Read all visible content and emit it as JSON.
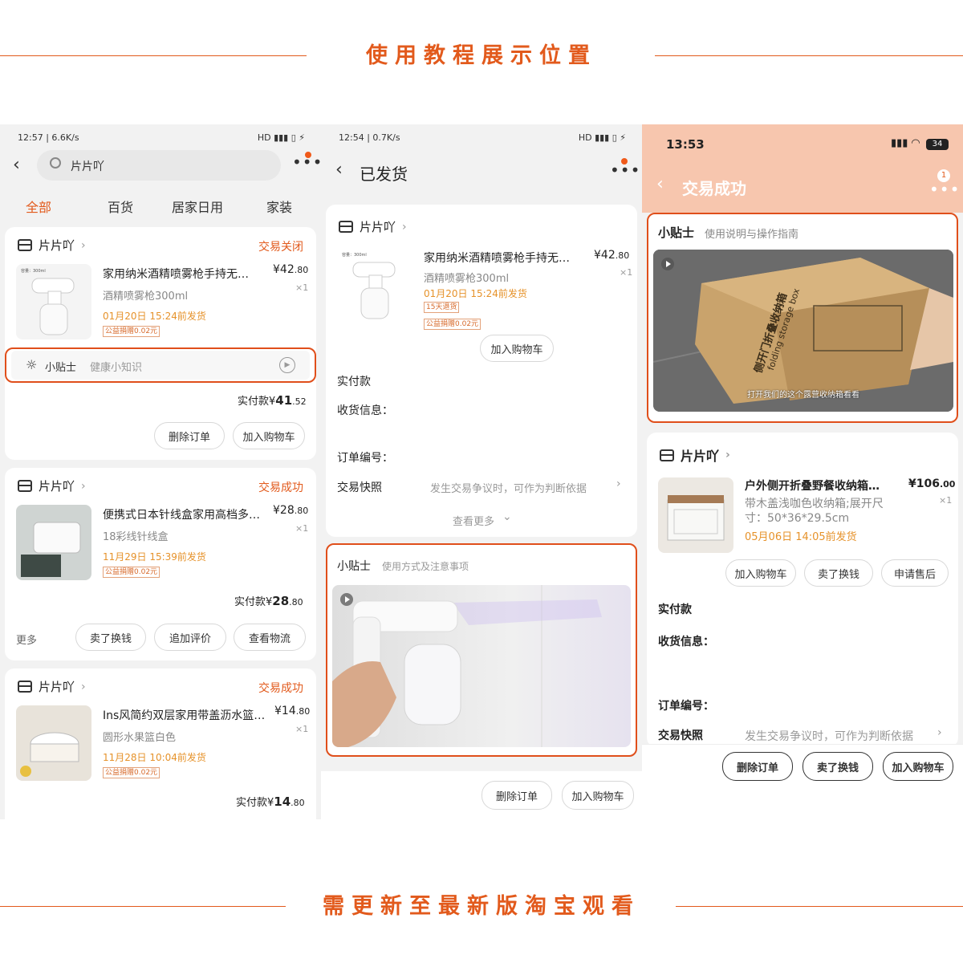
{
  "header_top": {
    "title": "使用教程展示位置"
  },
  "footer_bottom": {
    "title": "需更新至最新版淘宝观看"
  },
  "panel1": {
    "status_time": "12:57 | 6.6K/s",
    "status_right": "HD ▮▮▮ ▯ ⚡",
    "search_value": "片片吖",
    "tabs": [
      "全部",
      "百货",
      "居家日用",
      "家装"
    ],
    "order1": {
      "store": "片片吖",
      "state": "交易关闭",
      "thumb_text": "容量：300ml",
      "title": "家用纳米酒精喷雾枪手持无…",
      "spec": "酒精喷雾枪300ml",
      "date": "01月20日 15:24前发货",
      "tag": "公益捐赠0.02元",
      "price_symbol": "¥42",
      "price_dec": ".80",
      "qty": "×1",
      "tip_label": "小贴士",
      "tip_text": "健康小知识",
      "pay_label": "实付款¥",
      "pay_int": "41",
      "pay_dec": ".52",
      "btn1": "删除订单",
      "btn2": "加入购物车"
    },
    "order2": {
      "store": "片片吖",
      "state": "交易成功",
      "title": "便携式日本针线盒家用高档多…",
      "spec": "18彩线针线盒",
      "date": "11月29日 15:39前发货",
      "tag": "公益捐赠0.02元",
      "price_symbol": "¥28",
      "price_dec": ".80",
      "qty": "×1",
      "pay_label": "实付款¥",
      "pay_int": "28",
      "pay_dec": ".80",
      "more": "更多",
      "btn1": "卖了换钱",
      "btn2": "追加评价",
      "btn3": "查看物流"
    },
    "order3": {
      "store": "片片吖",
      "state": "交易成功",
      "title": "Ins风简约双层家用带盖沥水篮…",
      "spec": "圆形水果篮白色",
      "date": "11月28日 10:04前发货",
      "tag": "公益捐赠0.02元",
      "price_symbol": "¥14",
      "price_dec": ".80",
      "qty": "×1",
      "pay_label": "实付款¥",
      "pay_int": "14",
      "pay_dec": ".80"
    }
  },
  "panel2": {
    "status_time": "12:54 | 0.7K/s",
    "status_right": "HD ▮▮▮ ▯ ⚡",
    "title": "已发货",
    "store": "片片吖",
    "thumb_text": "容量：300ml",
    "product_title": "家用纳米酒精喷雾枪手持无…",
    "spec": "酒精喷雾枪300ml",
    "date": "01月20日 15:24前发货",
    "tag1": "15天退货",
    "tag2": "公益捐赠0.02元",
    "price_symbol": "¥42",
    "price_dec": ".80",
    "qty": "×1",
    "add_cart": "加入购物车",
    "paid": "实付款",
    "receive": "收货信息：",
    "order_no": "订单编号：",
    "snapshot": "交易快照",
    "snapshot_val": "发生交易争议时，可作为判断依据",
    "more": "查看更多",
    "tip_label": "小贴士",
    "tip_text": "使用方式及注意事项",
    "btn1": "删除订单",
    "btn2": "加入购物车"
  },
  "panel3": {
    "status_time": "13:53",
    "battery": "34",
    "title": "交易成功",
    "badge": "1",
    "tip_label": "小贴士",
    "tip_text": "使用说明与操作指南",
    "box_text": "侧开门折叠收纳箱",
    "box_text_en": "folding storage box",
    "subtitle": "打开我们的这个露营收纳箱看看",
    "store": "片片吖",
    "product_title": "户外侧开折叠野餐收纳箱…",
    "spec": "带木盖浅咖色收纳箱;展开尺寸：50*36*29.5cm",
    "date": "05月06日 14:05前发货",
    "price_symbol": "¥106",
    "price_dec": ".00",
    "qty": "×1",
    "btn_cart": "加入购物车",
    "btn_sell": "卖了换钱",
    "btn_after": "申请售后",
    "paid": "实付款",
    "receive": "收货信息：",
    "order_no": "订单编号：",
    "snapshot": "交易快照",
    "snapshot_val": "发生交易争议时，可作为判断依据",
    "bbtn1": "删除订单",
    "bbtn2": "卖了换钱",
    "bbtn3": "加入购物车"
  },
  "colors": {
    "accent": "#e25a1c",
    "date": "#e6922a",
    "header_bg": "#f7c6ae"
  }
}
